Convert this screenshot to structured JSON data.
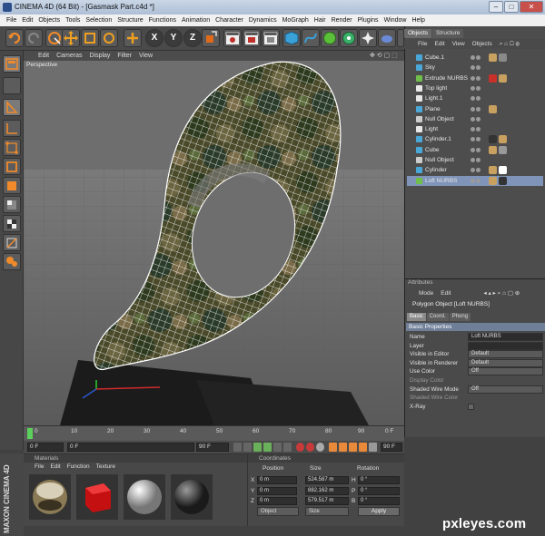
{
  "window": {
    "title": "CINEMA 4D (64 Bit) - [Gasmask Part.c4d *]"
  },
  "menubar": [
    "File",
    "Edit",
    "Objects",
    "Tools",
    "Selection",
    "Structure",
    "Functions",
    "Animation",
    "Character",
    "Dynamics",
    "MoGraph",
    "Hair",
    "Render",
    "Plugins",
    "Window",
    "Help"
  ],
  "toolbar": {
    "axis_x": "X",
    "axis_y": "Y",
    "axis_z": "Z"
  },
  "viewport": {
    "menu": [
      "Edit",
      "Cameras",
      "Display",
      "Filter",
      "View"
    ],
    "label": "Perspective"
  },
  "timeline": {
    "ticks": [
      "0",
      "10",
      "20",
      "30",
      "40",
      "50",
      "60",
      "70",
      "80",
      "90"
    ],
    "end_marker": "0 F",
    "start_field": "0 F",
    "current_field": "0 F",
    "end_field": "90 F",
    "right_field": "90 F"
  },
  "materials": {
    "title": "Materials",
    "menu": [
      "File",
      "Edit",
      "Function",
      "Texture"
    ],
    "swatches": [
      "chrome",
      "red-cube",
      "white-sphere",
      "dark-sphere"
    ]
  },
  "coordinates": {
    "title": "Coordinates",
    "headers": [
      "Position",
      "Size",
      "Rotation"
    ],
    "rows": [
      {
        "axis": "X",
        "pos": "0 m",
        "size": "524.587 m",
        "rot_axis": "H",
        "rot": "0 °"
      },
      {
        "axis": "Y",
        "pos": "0 m",
        "size": "882.162 m",
        "rot_axis": "P",
        "rot": "0 °"
      },
      {
        "axis": "Z",
        "pos": "0 m",
        "size": "579.517 m",
        "rot_axis": "B",
        "rot": "0 °"
      }
    ],
    "mode1": "Object",
    "mode2": "Size",
    "apply_label": "Apply"
  },
  "objects": {
    "tabs": [
      "Objects",
      "Structure"
    ],
    "menu": [
      "File",
      "Edit",
      "View",
      "Objects"
    ],
    "items": [
      {
        "label": "Cube.1",
        "icon": "#4aa8d8",
        "sel": false
      },
      {
        "label": "Sky",
        "icon": "#4aa8d8",
        "sel": false
      },
      {
        "label": "Extrude NURBS",
        "icon": "#6fbf4a",
        "sel": false
      },
      {
        "label": "Top light",
        "icon": "#e8e8e8",
        "sel": false
      },
      {
        "label": "Light.1",
        "icon": "#e8e8e8",
        "sel": false
      },
      {
        "label": "Plane",
        "icon": "#4aa8d8",
        "sel": false
      },
      {
        "label": "Null Object",
        "icon": "#cccccc",
        "sel": false
      },
      {
        "label": "Light",
        "icon": "#e8e8e8",
        "sel": false
      },
      {
        "label": "Cylinder.1",
        "icon": "#4aa8d8",
        "sel": false
      },
      {
        "label": "Cube",
        "icon": "#4aa8d8",
        "sel": false
      },
      {
        "label": "Null Object",
        "icon": "#cccccc",
        "sel": false
      },
      {
        "label": "Cylinder",
        "icon": "#4aa8d8",
        "sel": false
      },
      {
        "label": "Loft NURBS",
        "icon": "#6fbf4a",
        "sel": true
      }
    ]
  },
  "attributes": {
    "title": "Attributes",
    "menu": [
      "Mode",
      "Edit"
    ],
    "object_label": "Polygon Object [Loft NURBS]",
    "tabs": [
      "Basic",
      "Coord.",
      "Phong"
    ],
    "section": "Basic Properties",
    "rows": [
      {
        "label": "Name",
        "value": "Loft NURBS",
        "kind": "field"
      },
      {
        "label": "Layer",
        "value": "",
        "kind": "field"
      },
      {
        "label": "Visible in Editor",
        "value": "Default",
        "kind": "drop"
      },
      {
        "label": "Visible in Renderer",
        "value": "Default",
        "kind": "drop"
      },
      {
        "label": "Use Color",
        "value": "Off",
        "kind": "drop"
      },
      {
        "label": "Display Color",
        "value": "",
        "kind": "dim"
      },
      {
        "label": "Shaded Wire Mode",
        "value": "Off",
        "kind": "drop"
      },
      {
        "label": "Shaded Wire Color",
        "value": "",
        "kind": "dim"
      },
      {
        "label": "X-Ray",
        "value": "",
        "kind": "check"
      }
    ]
  },
  "brand": {
    "logo": "MAXON CINEMA 4D"
  },
  "watermark": "pxleyes.com",
  "colors": {
    "selection": "#7f94b8",
    "section_header": "#6f7f98",
    "viewport_bg": "#6c6c6c"
  }
}
